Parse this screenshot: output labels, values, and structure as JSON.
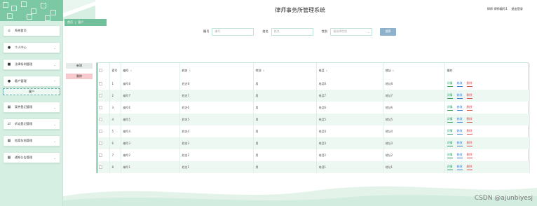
{
  "header": {
    "title": "律师事务所管理系统",
    "user_role": "律师",
    "user_name": "律师编号1",
    "logout": "退出登录"
  },
  "breadcrumb": {
    "home": "首页",
    "current": "客户",
    "separator": "/"
  },
  "sidebar": {
    "items": [
      {
        "label": "系统首页",
        "icon": "home-icon"
      },
      {
        "label": "个人中心",
        "icon": "user-icon"
      },
      {
        "label": "法律条例管理",
        "icon": "checkbox-icon"
      },
      {
        "label": "客户管理",
        "icon": "user-icon",
        "sub": "客户"
      },
      {
        "label": "案件登记管理",
        "icon": "grid-icon"
      },
      {
        "label": "诉讼登记管理",
        "icon": "swap-icon"
      },
      {
        "label": "档案存档管理",
        "icon": "grid-icon"
      },
      {
        "label": "通知公告管理",
        "icon": "grid-icon"
      }
    ]
  },
  "search": {
    "label1": "编号",
    "placeholder1": "编号",
    "label2": "姓名",
    "placeholder2": "姓名",
    "label3": "性别",
    "placeholder3": "请选择性别",
    "button": "搜索"
  },
  "actions": {
    "add": "新增",
    "delete": "删除"
  },
  "table": {
    "headers": {
      "index": "索引",
      "code": "编号",
      "name": "姓名",
      "gender": "性别",
      "phone": "电话",
      "address": "地址",
      "ops": "操作"
    },
    "op_labels": {
      "view": "详情",
      "edit": "修改",
      "delete": "删除"
    },
    "rows": [
      {
        "index": "1",
        "code": "编号8",
        "name": "姓名8",
        "gender": "男",
        "phone": "电话8",
        "address": "地址8"
      },
      {
        "index": "2",
        "code": "编号7",
        "name": "姓名7",
        "gender": "男",
        "phone": "电话7",
        "address": "地址7"
      },
      {
        "index": "3",
        "code": "编号6",
        "name": "姓名6",
        "gender": "男",
        "phone": "电话6",
        "address": "地址6"
      },
      {
        "index": "4",
        "code": "编号5",
        "name": "姓名5",
        "gender": "男",
        "phone": "电话5",
        "address": "地址5"
      },
      {
        "index": "5",
        "code": "编号4",
        "name": "姓名4",
        "gender": "男",
        "phone": "电话4",
        "address": "地址4"
      },
      {
        "index": "6",
        "code": "编号3",
        "name": "姓名3",
        "gender": "男",
        "phone": "电话3",
        "address": "地址3"
      },
      {
        "index": "7",
        "code": "编号2",
        "name": "姓名2",
        "gender": "男",
        "phone": "电话2",
        "address": "地址2"
      },
      {
        "index": "8",
        "code": "编号1",
        "name": "姓名1",
        "gender": "男",
        "phone": "电话1",
        "address": "地址1"
      }
    ]
  },
  "watermark": "CSDN @ajunbiyesj",
  "colors": {
    "accent": "#6fbf9b",
    "sidebar": "#d6efe3",
    "search_button": "#8fb2cc",
    "view": "#2d9b66",
    "edit": "#3a7bd5",
    "delete": "#e04b55"
  }
}
